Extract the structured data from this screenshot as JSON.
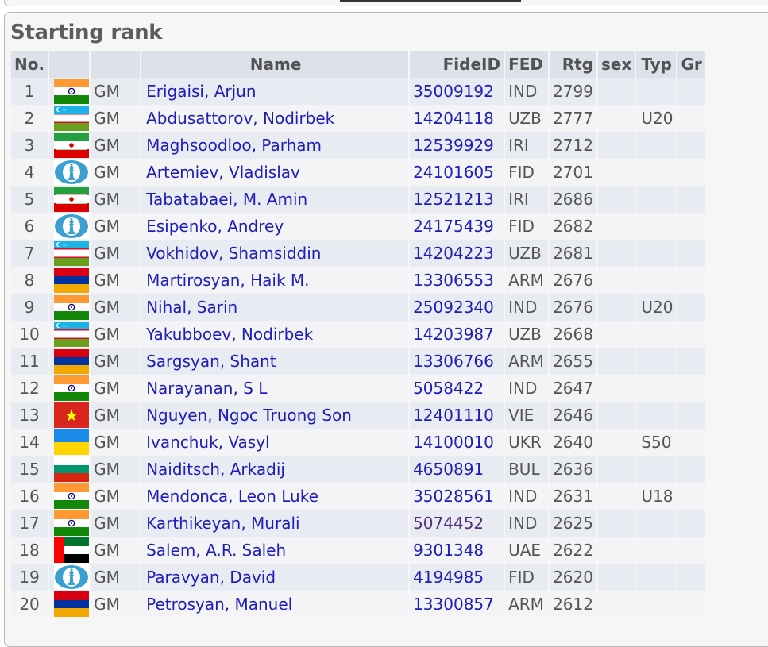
{
  "section_title": "Starting rank",
  "columns": {
    "no": "No.",
    "flag": "",
    "title": "",
    "name": "Name",
    "fide_id": "FideID",
    "fed": "FED",
    "rating": "Rtg",
    "sex": "sex",
    "type": "Typ",
    "group": "Gr"
  },
  "rows": [
    {
      "no": "1",
      "flag": "IND",
      "title": "GM",
      "name": "Erigaisi, Arjun",
      "fide_id": "35009192",
      "fed": "IND",
      "rating": "2799",
      "sex": "",
      "type": "",
      "group": ""
    },
    {
      "no": "2",
      "flag": "UZB",
      "title": "GM",
      "name": "Abdusattorov, Nodirbek",
      "fide_id": "14204118",
      "fed": "UZB",
      "rating": "2777",
      "sex": "",
      "type": "U20",
      "group": ""
    },
    {
      "no": "3",
      "flag": "IRI",
      "title": "GM",
      "name": "Maghsoodloo, Parham",
      "fide_id": "12539929",
      "fed": "IRI",
      "rating": "2712",
      "sex": "",
      "type": "",
      "group": ""
    },
    {
      "no": "4",
      "flag": "FID",
      "title": "GM",
      "name": "Artemiev, Vladislav",
      "fide_id": "24101605",
      "fed": "FID",
      "rating": "2701",
      "sex": "",
      "type": "",
      "group": ""
    },
    {
      "no": "5",
      "flag": "IRI",
      "title": "GM",
      "name": "Tabatabaei, M. Amin",
      "fide_id": "12521213",
      "fed": "IRI",
      "rating": "2686",
      "sex": "",
      "type": "",
      "group": ""
    },
    {
      "no": "6",
      "flag": "FID",
      "title": "GM",
      "name": "Esipenko, Andrey",
      "fide_id": "24175439",
      "fed": "FID",
      "rating": "2682",
      "sex": "",
      "type": "",
      "group": ""
    },
    {
      "no": "7",
      "flag": "UZB",
      "title": "GM",
      "name": "Vokhidov, Shamsiddin",
      "fide_id": "14204223",
      "fed": "UZB",
      "rating": "2681",
      "sex": "",
      "type": "",
      "group": ""
    },
    {
      "no": "8",
      "flag": "ARM",
      "title": "GM",
      "name": "Martirosyan, Haik M.",
      "fide_id": "13306553",
      "fed": "ARM",
      "rating": "2676",
      "sex": "",
      "type": "",
      "group": ""
    },
    {
      "no": "9",
      "flag": "IND",
      "title": "GM",
      "name": "Nihal, Sarin",
      "fide_id": "25092340",
      "fed": "IND",
      "rating": "2676",
      "sex": "",
      "type": "U20",
      "group": ""
    },
    {
      "no": "10",
      "flag": "UZB",
      "title": "GM",
      "name": "Yakubboev, Nodirbek",
      "fide_id": "14203987",
      "fed": "UZB",
      "rating": "2668",
      "sex": "",
      "type": "",
      "group": ""
    },
    {
      "no": "11",
      "flag": "ARM",
      "title": "GM",
      "name": "Sargsyan, Shant",
      "fide_id": "13306766",
      "fed": "ARM",
      "rating": "2655",
      "sex": "",
      "type": "",
      "group": ""
    },
    {
      "no": "12",
      "flag": "IND",
      "title": "GM",
      "name": "Narayanan, S L",
      "fide_id": "5058422",
      "fed": "IND",
      "rating": "2647",
      "sex": "",
      "type": "",
      "group": ""
    },
    {
      "no": "13",
      "flag": "VIE",
      "title": "GM",
      "name": "Nguyen, Ngoc Truong Son",
      "fide_id": "12401110",
      "fed": "VIE",
      "rating": "2646",
      "sex": "",
      "type": "",
      "group": ""
    },
    {
      "no": "14",
      "flag": "UKR",
      "title": "GM",
      "name": "Ivanchuk, Vasyl",
      "fide_id": "14100010",
      "fed": "UKR",
      "rating": "2640",
      "sex": "",
      "type": "S50",
      "group": ""
    },
    {
      "no": "15",
      "flag": "BUL",
      "title": "GM",
      "name": "Naiditsch, Arkadij",
      "fide_id": "4650891",
      "fed": "BUL",
      "rating": "2636",
      "sex": "",
      "type": "",
      "group": ""
    },
    {
      "no": "16",
      "flag": "IND",
      "title": "GM",
      "name": "Mendonca, Leon Luke",
      "fide_id": "35028561",
      "fed": "IND",
      "rating": "2631",
      "sex": "",
      "type": "U18",
      "group": ""
    },
    {
      "no": "17",
      "flag": "IND",
      "title": "GM",
      "name": "Karthikeyan, Murali",
      "fide_id": "5074452",
      "fed": "IND",
      "rating": "2625",
      "sex": "",
      "type": "",
      "group": "",
      "fide_visited": true
    },
    {
      "no": "18",
      "flag": "UAE",
      "title": "GM",
      "name": "Salem, A.R. Saleh",
      "fide_id": "9301348",
      "fed": "UAE",
      "rating": "2622",
      "sex": "",
      "type": "",
      "group": ""
    },
    {
      "no": "19",
      "flag": "FID",
      "title": "GM",
      "name": "Paravyan, David",
      "fide_id": "4194985",
      "fed": "FID",
      "rating": "2620",
      "sex": "",
      "type": "",
      "group": ""
    },
    {
      "no": "20",
      "flag": "ARM",
      "title": "GM",
      "name": "Petrosyan, Manuel",
      "fide_id": "13300857",
      "fed": "ARM",
      "rating": "2612",
      "sex": "",
      "type": "",
      "group": ""
    }
  ],
  "colors": {
    "link": "#1d1db7",
    "visited_link": "#55307a",
    "header_bg": "#dde1ea",
    "row_odd_bg": "#e9ebf2",
    "row_even_bg": "#f4f4f7"
  }
}
